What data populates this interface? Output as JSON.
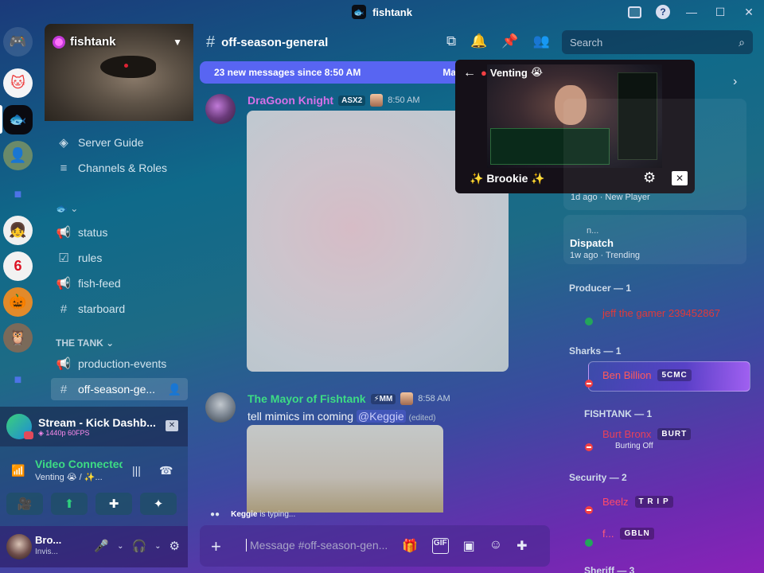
{
  "window": {
    "title": "fishtank"
  },
  "server": {
    "name": "fishtank",
    "links": [
      {
        "label": "Server Guide"
      },
      {
        "label": "Channels & Roles"
      }
    ],
    "channels": [
      {
        "name": "status"
      },
      {
        "name": "rules"
      },
      {
        "name": "fish-feed"
      },
      {
        "name": "starboard"
      }
    ],
    "category": "THE TANK",
    "tank_channels": [
      {
        "name": "production-events"
      },
      {
        "name": "off-season-ge..."
      }
    ]
  },
  "stream": {
    "title": "Stream - Kick Dashb...",
    "quality": "1440p 60FPS"
  },
  "voice": {
    "status": "Video Connected",
    "channel": "Venting 😭 / ✨..."
  },
  "user": {
    "name": "Bro...",
    "status": "Invis..."
  },
  "chat": {
    "channel": "off-season-general",
    "search_placeholder": "Search",
    "new_messages": "23 new messages since 8:50 AM",
    "new_messages_action": "Ma",
    "messages": [
      {
        "author": "DraGoon Knight",
        "tag": "ASX2",
        "time": "8:50 AM",
        "text": ""
      },
      {
        "author": "The Mayor of Fishtank",
        "tag": "MM",
        "time": "8:58 AM",
        "text": "tell mimics im coming ",
        "mention": "@Keggie",
        "edited": "(edited)"
      }
    ],
    "typing_user": "Keggie",
    "typing_suffix": " is typing...",
    "composer_placeholder": "Message #off-season-gen..."
  },
  "pip": {
    "title": "Venting",
    "streamer": "✨ Brookie ✨"
  },
  "members": {
    "card1_meta": "1d ago  ·  New Player",
    "card2_n": "n...",
    "card2_title": "Dispatch",
    "card2_meta": "1w ago  ·  Trending",
    "groups": [
      {
        "role": "Producer — 1",
        "members": [
          {
            "name": "jeff the gamer 239452867",
            "tag": "",
            "color": "#e03a3a"
          }
        ]
      },
      {
        "role": "Sharks — 1",
        "members": [
          {
            "name": "Ben Billion",
            "tag": "5CMC",
            "color": "#ff5a5a"
          }
        ]
      },
      {
        "role": "FISHTANK — 1",
        "members": [
          {
            "name": "Burt Bronx",
            "tag": "BURT",
            "color": "#e8415a",
            "sub": "Burting Off"
          }
        ]
      },
      {
        "role": "Security — 2",
        "members": [
          {
            "name": "Beelz",
            "tag": "T R I P",
            "color": "#ff4a6a"
          },
          {
            "name": "f...",
            "tag": "GBLN",
            "color": "#ff5a7a"
          }
        ]
      },
      {
        "role": "Sheriff — 3",
        "members": []
      }
    ]
  },
  "colors": {
    "accent": "#5865f2",
    "online": "#23a55a",
    "dnd": "#f23f43",
    "mayor": "#3ddc84",
    "dragoon": "#d670e8"
  }
}
